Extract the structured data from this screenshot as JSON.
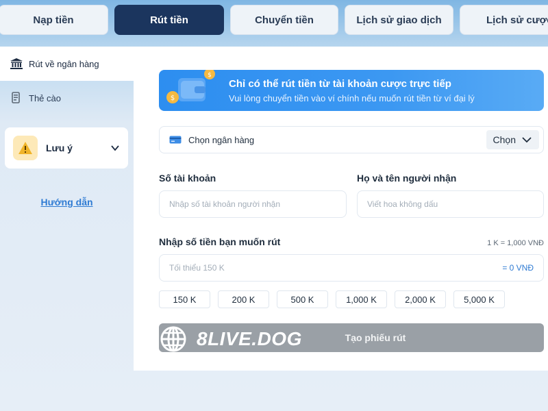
{
  "tabs": [
    {
      "label": "Nạp tiền",
      "active": false
    },
    {
      "label": "Rút tiền",
      "active": true
    },
    {
      "label": "Chuyển tiền",
      "active": false
    },
    {
      "label": "Lịch sử giao dịch",
      "active": false
    },
    {
      "label": "Lịch sử cược",
      "active": false
    }
  ],
  "sidebar": {
    "items": [
      {
        "label": "Rút về ngân hàng",
        "icon": "bank-icon",
        "active": true
      },
      {
        "label": "Thẻ cào",
        "icon": "card-icon",
        "active": false
      }
    ],
    "note_label": "Lưu ý",
    "guide_link": "Hướng dẫn"
  },
  "banner": {
    "title": "Chỉ có thể rút tiền từ tài khoản cược trực tiếp",
    "subtitle": "Vui lòng chuyển tiền vào ví chính nếu muốn rút tiền từ ví đại lý"
  },
  "bank_select": {
    "label": "Chọn ngân hàng",
    "button": "Chọn"
  },
  "account": {
    "label": "Số tài khoản",
    "placeholder": "Nhập số tài khoản người nhận"
  },
  "recipient": {
    "label": "Họ và tên người nhận",
    "placeholder": "Viết hoa không dấu"
  },
  "amount": {
    "label": "Nhập số tiền bạn muốn rút",
    "rate": "1 K = 1,000 VNĐ",
    "placeholder": "Tối thiểu 150 K",
    "equals": "= 0 VNĐ"
  },
  "chips": [
    "150 K",
    "200 K",
    "500 K",
    "1,000 K",
    "2,000 K",
    "5,000 K"
  ],
  "submit_label": "Tạo phiếu rút",
  "watermark": "8LIVE.DOG",
  "colors": {
    "accent": "#1b355e",
    "banner": "#2d8ef0",
    "link": "#2f7bd3",
    "disabled": "#9aa0a6",
    "warning": "#f0b429"
  }
}
